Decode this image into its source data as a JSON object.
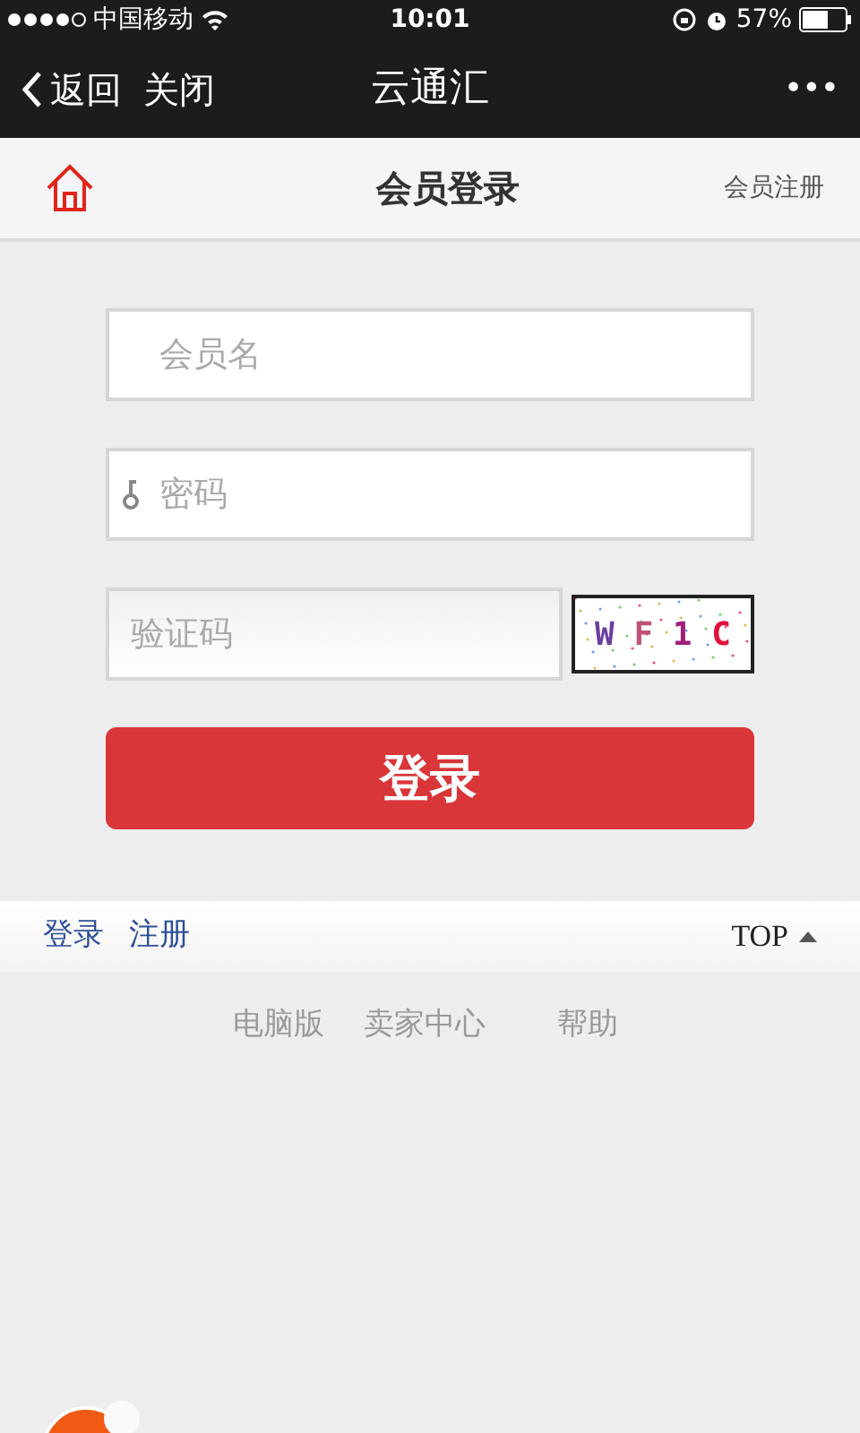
{
  "status_bar": {
    "carrier": "中国移动",
    "time": "10:01",
    "battery": "57%"
  },
  "nav_bar": {
    "back": "返回",
    "close": "关闭",
    "title": "云通汇",
    "more": "•••"
  },
  "header": {
    "title": "会员登录",
    "register": "会员注册"
  },
  "form": {
    "username": {
      "placeholder": "会员名"
    },
    "password": {
      "placeholder": "密码"
    },
    "captcha": {
      "placeholder": "验证码",
      "code": "W F 1 C"
    },
    "submit": "登录"
  },
  "footer_bar": {
    "links": [
      "登录",
      "注册"
    ],
    "top": "TOP"
  },
  "footer_links": [
    "电脑版",
    "卖家中心",
    "帮助"
  ]
}
